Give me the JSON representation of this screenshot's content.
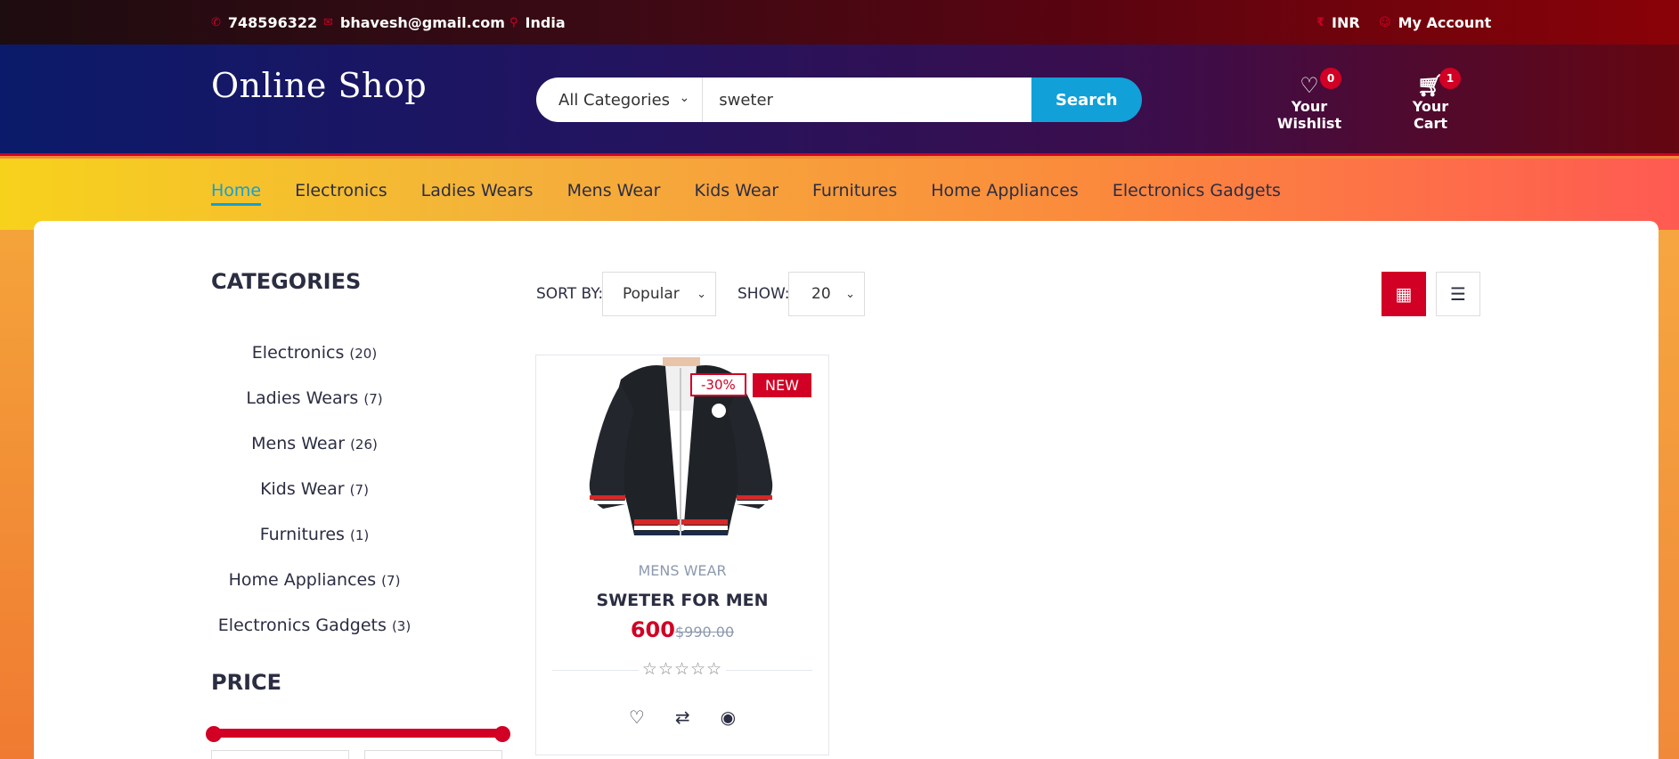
{
  "topbar": {
    "phone": "748596322",
    "email": "bhavesh@gmail.com",
    "location": "India",
    "currency": "INR",
    "account": "My Account"
  },
  "header": {
    "logo": "Online Shop",
    "category_select": "All Categories",
    "search_value": "sweter",
    "search_button": "Search",
    "wishlist_label": "Your Wishlist",
    "wishlist_count": "0",
    "cart_label": "Your Cart",
    "cart_count": "1"
  },
  "nav": {
    "items": [
      "Home",
      "Electronics",
      "Ladies Wears",
      "Mens Wear",
      "Kids Wear",
      "Furnitures",
      "Home Appliances",
      "Electronics Gadgets"
    ]
  },
  "sidebar": {
    "categories_title": "CATEGORIES",
    "categories": [
      {
        "name": "Electronics",
        "count": "(20)"
      },
      {
        "name": "Ladies Wears",
        "count": "(7)"
      },
      {
        "name": "Mens Wear",
        "count": "(26)"
      },
      {
        "name": "Kids Wear",
        "count": "(7)"
      },
      {
        "name": "Furnitures",
        "count": "(1)"
      },
      {
        "name": "Home Appliances",
        "count": "(7)"
      },
      {
        "name": "Electronics Gadgets",
        "count": "(3)"
      }
    ],
    "price_title": "PRICE"
  },
  "store": {
    "sort_label": "SORT BY:",
    "sort_value": "Popular",
    "show_label": "SHOW:",
    "show_value": "20"
  },
  "product": {
    "sale_label": "-30%",
    "new_label": "NEW",
    "category": "MENS WEAR",
    "name": "SWETER FOR MEN",
    "price": "600",
    "old_price": "$990.00",
    "rating": 0
  },
  "colors": {
    "accent": "#d10024",
    "search_button": "#11a0d8"
  }
}
